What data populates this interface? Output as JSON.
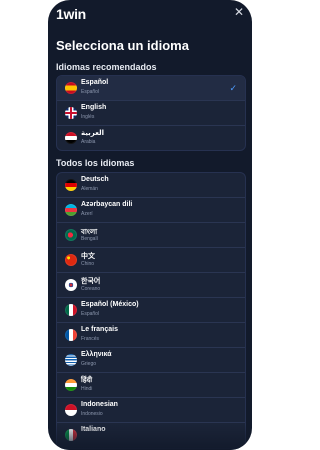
{
  "header": {
    "logo_text": "1win",
    "close_icon": "close-icon"
  },
  "page": {
    "title": "Selecciona un idioma"
  },
  "recommended": {
    "title": "Idiomas recomendados",
    "items": [
      {
        "name": "Español",
        "sub": "Español",
        "selected": true
      },
      {
        "name": "English",
        "sub": "Inglés",
        "selected": false
      },
      {
        "name": "العربية",
        "sub": "Arabia",
        "selected": false
      }
    ]
  },
  "all": {
    "title": "Todos los idiomas",
    "items": [
      {
        "name": "Deutsch",
        "sub": "Alemán"
      },
      {
        "name": "Azərbaycan dili",
        "sub": "Azerí"
      },
      {
        "name": "বাংলা",
        "sub": "Bengalí"
      },
      {
        "name": "中文",
        "sub": "Chino"
      },
      {
        "name": "한국어",
        "sub": "Coreano"
      },
      {
        "name": "Español (México)",
        "sub": "Español"
      },
      {
        "name": "Le français",
        "sub": "Francés"
      },
      {
        "name": "Ελληνικά",
        "sub": "Griego"
      },
      {
        "name": "हिंदी",
        "sub": "Hindi"
      },
      {
        "name": "Indonesian",
        "sub": "Indonesio"
      },
      {
        "name": "Italiano",
        "sub": ""
      }
    ]
  },
  "icons": {
    "selected_check": "✓"
  }
}
